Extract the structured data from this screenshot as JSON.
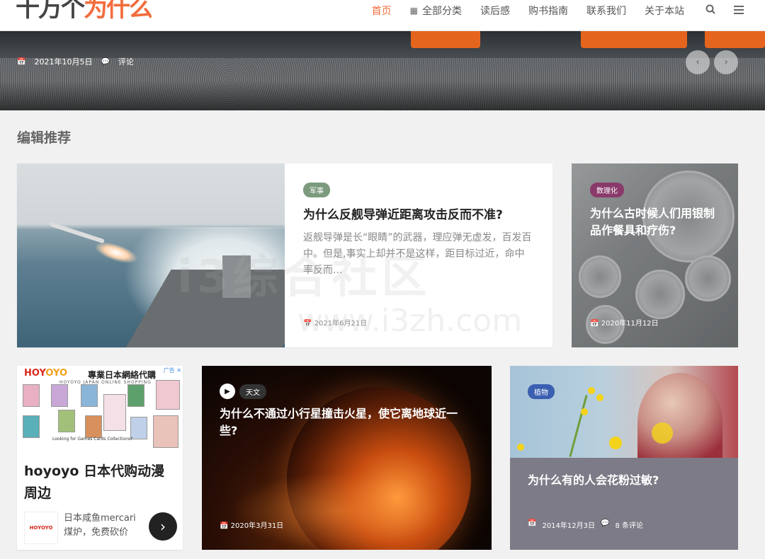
{
  "header": {
    "logo_a": "十万个",
    "logo_b": "为什么",
    "nav": [
      {
        "label": "首页",
        "active": true
      },
      {
        "label": "全部分类",
        "icon": "grid-icon"
      },
      {
        "label": "读后感"
      },
      {
        "label": "购书指南"
      },
      {
        "label": "联系我们"
      },
      {
        "label": "关于本站"
      }
    ]
  },
  "hero": {
    "date": "2021年10月5日",
    "comment": "评论"
  },
  "section": {
    "title": "编辑推荐"
  },
  "cards": {
    "c1": {
      "tag": "军事",
      "tag_color": "#7c9a7e",
      "title": "为什么反舰导弹近距离攻击反而不准?",
      "excerpt": "返舰导弹是长“眼睛”的武器，理应弹无虚发，百发百中。但是,事实上却并不是这样，距目标过近，命中率反而...",
      "date": "2021年6月21日"
    },
    "c2": {
      "tag": "数理化",
      "tag_color": "#8a3a6a",
      "title": "为什么古时候人们用银制品作餐具和疗伤?",
      "date": "2020年11月12日"
    },
    "c3": {
      "tag": "天文",
      "tag_color": "#333333",
      "title": "为什么不通过小行星撞击火星，使它离地球近一些?",
      "date": "2020年3月31日"
    },
    "c4": {
      "tag": "植物",
      "tag_color": "#3a5fb0",
      "title": "为什么有的人会花粉过敏?",
      "date": "2014年12月3日",
      "comments": "8 条评论"
    }
  },
  "ad": {
    "brand_a": "HOY",
    "brand_b": "OYO",
    "slogan": "專業日本網絡代購",
    "sub": "HOYOYO JAPAN ONLINE SHOPPING",
    "mark": "广告",
    "looking": "Looking for Games Cards Collections?",
    "title": "hoyoyo 日本代购动漫周边",
    "logo2": "HOYOYO",
    "desc": "日本咸鱼mercari煤炉，免费砍价",
    "colors": {
      "brand": "#d9281d",
      "accent": "#f4a01c"
    }
  },
  "watermark": {
    "text": "i3综合社区",
    "url": "www.i3zh.com"
  }
}
